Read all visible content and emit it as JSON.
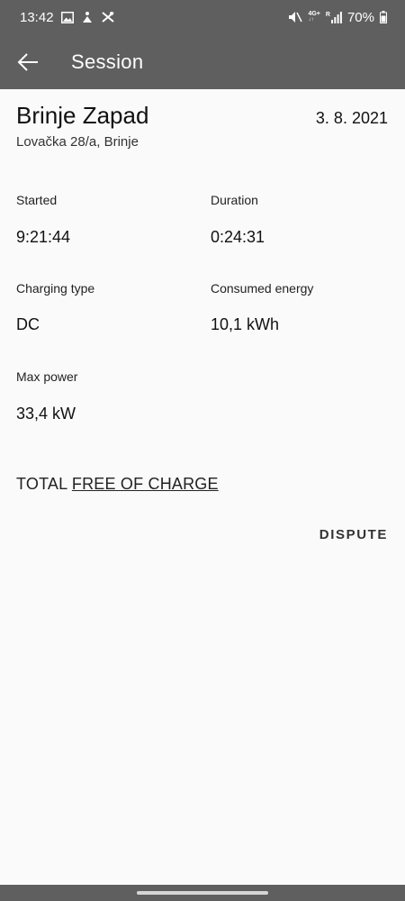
{
  "status_bar": {
    "time": "13:42",
    "network": "4G+",
    "roaming": "R",
    "battery": "70%"
  },
  "app_bar": {
    "title": "Session"
  },
  "station": {
    "name": "Brinje Zapad",
    "date": "3. 8. 2021",
    "address": "Lovačka 28/a, Brinje"
  },
  "fields": {
    "started": {
      "label": "Started",
      "value": "9:21:44"
    },
    "duration": {
      "label": "Duration",
      "value": "0:24:31"
    },
    "charging_type": {
      "label": "Charging type",
      "value": "DC"
    },
    "consumed_energy": {
      "label": "Consumed energy",
      "value": "10,1 kWh"
    },
    "max_power": {
      "label": "Max power",
      "value": "33,4 kW"
    }
  },
  "total": {
    "label": "TOTAL",
    "amount": "FREE OF CHARGE"
  },
  "actions": {
    "dispute_label": "DISPUTE"
  },
  "colors": {
    "bars": "#5f5f5f",
    "background": "#fafafa"
  }
}
